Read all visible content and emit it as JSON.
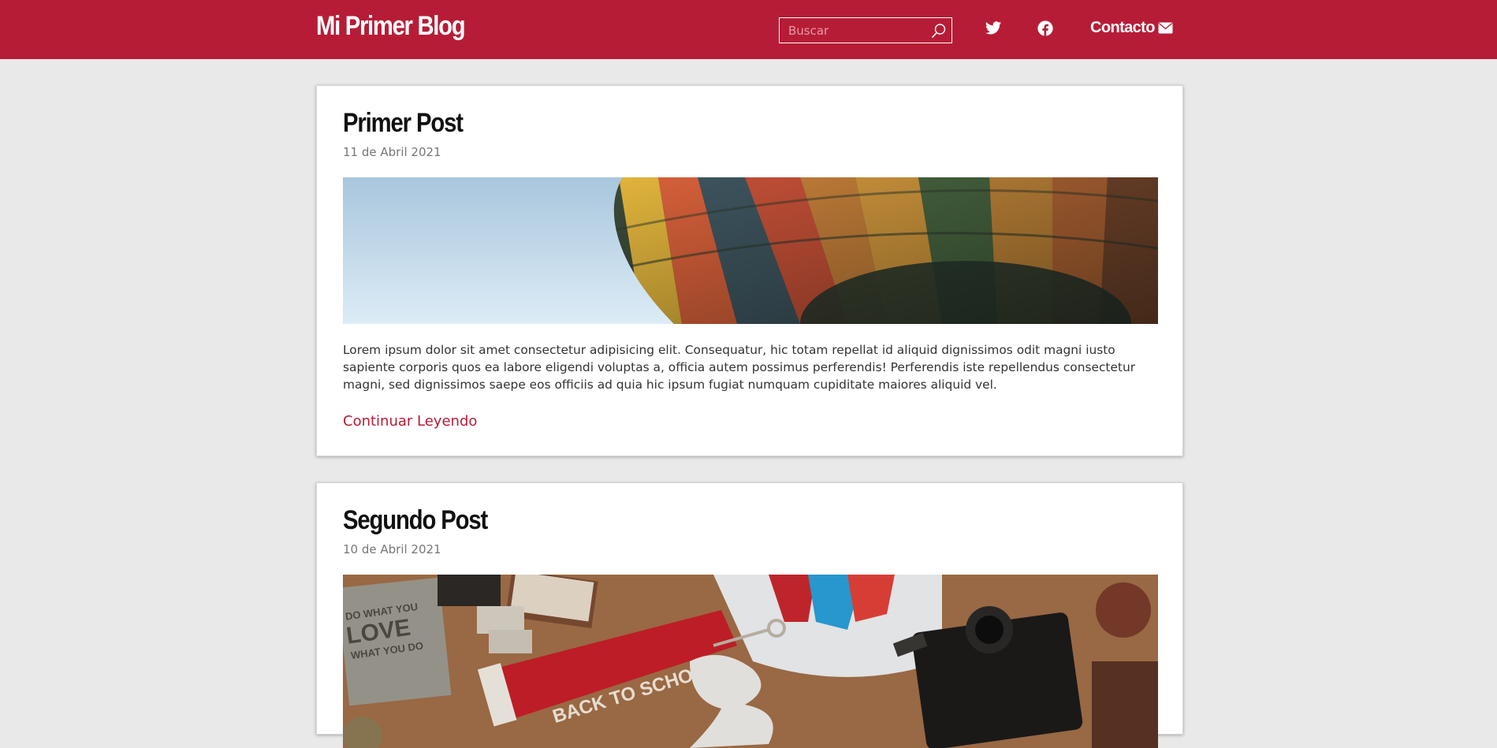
{
  "header": {
    "brand": "Mi Primer Blog",
    "search_placeholder": "Buscar",
    "contact_label": "Contacto",
    "icons": [
      "search-icon",
      "twitter-icon",
      "facebook-icon",
      "mail-icon"
    ]
  },
  "colors": {
    "header_bg": "#b71c36",
    "page_bg": "#e9e9e9",
    "link": "#b71c36"
  },
  "posts": [
    {
      "title": "Primer Post",
      "date": "11 de Abril 2021",
      "image": "hot-air-balloon-photo",
      "excerpt": "Lorem ipsum dolor sit amet consectetur adipisicing elit. Consequatur, hic totam repellat id aliquid dignissimos odit magni iusto sapiente corporis quos ea labore eligendi voluptas a, officia autem possimus perferendis! Perferendis iste repellendus consectetur magni, sed dignissimos saepe eos officiis ad quia hic ipsum fugiat numquam cupiditate maiores aliquid vel.",
      "link_label": "Continuar Leyendo"
    },
    {
      "title": "Segundo Post",
      "date": "10 de Abril 2021",
      "image": "back-to-school-flatlay-photo",
      "image_text": {
        "notebook_line1": "DO WHAT YOU",
        "notebook_line2": "LOVE",
        "notebook_line3": "WHAT YOU DO",
        "pennant": "BACK TO SCHOOL"
      }
    }
  ]
}
